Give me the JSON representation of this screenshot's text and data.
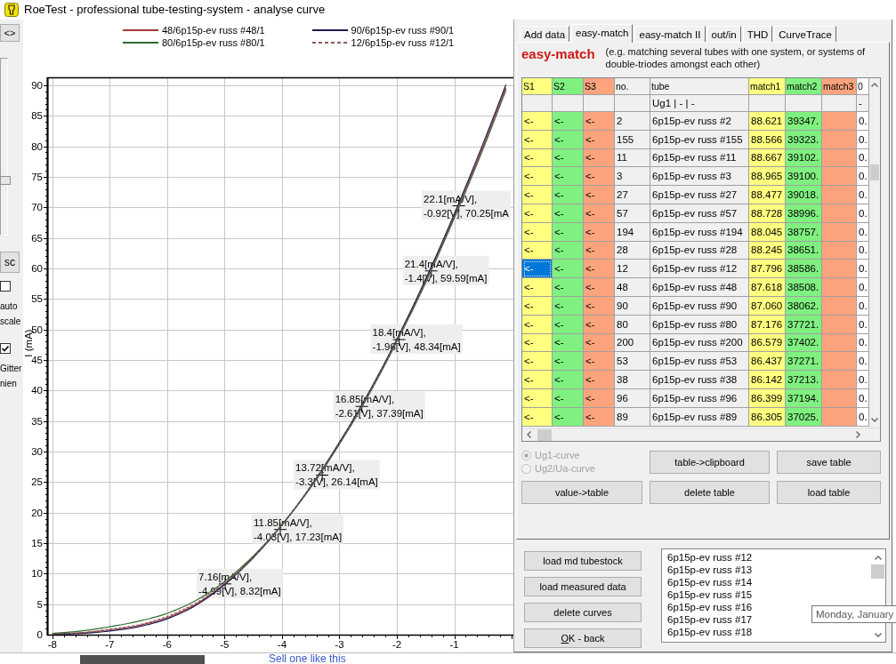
{
  "window": {
    "title": "RoeTest - professional tube-testing-system - analyse curve"
  },
  "left_strip": {
    "toggle_button": "<>",
    "slider": {
      "level": 0.3
    },
    "button": "sc",
    "options": [
      {
        "label": "auto scale",
        "checked": false
      },
      {
        "label": "Gitter nien",
        "checked": true
      }
    ]
  },
  "chart": {
    "chart_data": {
      "type": "line",
      "ylabel": "I (mA)",
      "grid": true,
      "legend": "top",
      "x": [
        -8,
        -7.5,
        -7,
        -6.5,
        -6,
        -5.5,
        -5,
        -4.5,
        -4,
        -3.5,
        -3,
        -2.5,
        -2,
        -1.5,
        -1,
        -0.5,
        -0.1
      ],
      "series": [
        {
          "name": "48/6p15p-ev russ #48/1",
          "color": "#a83a3a",
          "line_style": "solid",
          "values": [
            0.1,
            0.3,
            0.8,
            1.5,
            2.8,
            5.0,
            8.3,
            12.7,
            18.0,
            24.2,
            31.4,
            39.3,
            48.2,
            57.9,
            68.5,
            79.9,
            89.6
          ]
        },
        {
          "name": "90/6p15p-ev russ #90/1",
          "color": "#1a1a50",
          "line_style": "solid",
          "values": [
            0.1,
            0.2,
            0.6,
            1.3,
            2.6,
            4.8,
            8.2,
            12.6,
            18.0,
            24.3,
            31.5,
            39.5,
            48.4,
            58.2,
            68.9,
            80.4,
            90.1
          ]
        },
        {
          "name": "80/6p15p-ev russ #80/1",
          "color": "#2f6b2f",
          "line_style": "solid",
          "values": [
            0.2,
            0.6,
            1.3,
            2.2,
            3.5,
            5.6,
            8.7,
            12.9,
            18.0,
            24.1,
            31.2,
            39.1,
            48.0,
            57.6,
            68.2,
            79.5,
            89.2
          ]
        },
        {
          "name": "12/6p15p-ev russ #12/1",
          "color": "#8a5a5a",
          "line_style": "dashed",
          "values": [
            0.1,
            0.3,
            0.9,
            1.6,
            3.0,
            5.2,
            8.4,
            12.7,
            18.0,
            24.2,
            31.3,
            39.3,
            48.2,
            57.8,
            68.4,
            79.7,
            89.4
          ]
        }
      ],
      "xlim": [
        -8.09,
        0.03
      ],
      "ylim": [
        0,
        91.3
      ],
      "xticks": [
        -8,
        -7,
        -6,
        -5,
        -4,
        -3,
        -2,
        -1
      ],
      "yticks": [
        0,
        5,
        10,
        15,
        20,
        25,
        30,
        35,
        40,
        45,
        50,
        55,
        60,
        65,
        70,
        75,
        80,
        85,
        90
      ],
      "annotations": [
        {
          "x": -4.99,
          "y": 8.32,
          "text": "7.16[mA/V],\n-4.99[V], 8.32[mA]"
        },
        {
          "x": -4.03,
          "y": 17.23,
          "text": "11.85[mA/V],\n-4.03[V], 17.23[mA]"
        },
        {
          "x": -3.3,
          "y": 26.14,
          "text": "13.72[mA/V],\n-3.3[V], 26.14[mA]"
        },
        {
          "x": -2.61,
          "y": 37.39,
          "text": "16.85[mA/V],\n-2.61[V], 37.39[mA]"
        },
        {
          "x": -1.96,
          "y": 48.34,
          "text": "18.4[mA/V],\n-1.96[V], 48.34[mA]"
        },
        {
          "x": -1.4,
          "y": 59.59,
          "text": "21.4[mA/V],\n-1.4[V], 59.59[mA]"
        },
        {
          "x": -0.92,
          "y": 70.25,
          "text": "22.1[mA/V],\n-0.92[V], 70.25[mA"
        }
      ]
    }
  },
  "panel": {
    "tabs": [
      {
        "label": "Add data",
        "selected": false
      },
      {
        "label": "easy-match",
        "selected": true
      },
      {
        "label": "easy-match II",
        "selected": false
      },
      {
        "label": "out/in",
        "selected": false
      },
      {
        "label": "THD",
        "selected": false
      },
      {
        "label": "CurveTrace",
        "selected": false
      }
    ],
    "heading": "easy-match",
    "description": "(e.g. matching several tubes with one system, or systems of double-triodes amongst each other)",
    "table": {
      "columns": [
        {
          "label": "S1",
          "color": "#ffff80"
        },
        {
          "label": "S2",
          "color": "#80f080"
        },
        {
          "label": "S3",
          "color": "#fca47e"
        },
        {
          "label": "no.",
          "color": "#f0f0f0"
        },
        {
          "label": "tube",
          "sub": "Ug1 | - | -",
          "color": "#f0f0f0"
        },
        {
          "label": "match1",
          "color": "#ffff80"
        },
        {
          "label": "match2",
          "color": "#80f080"
        },
        {
          "label": "match3",
          "color": "#fca47e"
        },
        {
          "label": "0",
          "sub": "-",
          "color": "#ffffff"
        }
      ],
      "rows": [
        {
          "s1": "<-",
          "s2": "<-",
          "s3": "<-",
          "no": "2",
          "tube": "6p15p-ev russ #2",
          "match1": "88.621",
          "match2": "39347.",
          "column_9": "0.",
          "selected": false
        },
        {
          "s1": "<-",
          "s2": "<-",
          "s3": "<-",
          "no": "155",
          "tube": "6p15p-ev russ #155",
          "match1": "88.566",
          "match2": "39323.",
          "column_9": "0.",
          "selected": false
        },
        {
          "s1": "<-",
          "s2": "<-",
          "s3": "<-",
          "no": "11",
          "tube": "6p15p-ev russ #11",
          "match1": "88.667",
          "match2": "39102.",
          "column_9": "0.",
          "selected": false
        },
        {
          "s1": "<-",
          "s2": "<-",
          "s3": "<-",
          "no": "3",
          "tube": "6p15p-ev russ #3",
          "match1": "88.965",
          "match2": "39100.",
          "column_9": "0.",
          "selected": false
        },
        {
          "s1": "<-",
          "s2": "<-",
          "s3": "<-",
          "no": "27",
          "tube": "6p15p-ev russ #27",
          "match1": "88.477",
          "match2": "39018.",
          "column_9": "0.",
          "selected": false
        },
        {
          "s1": "<-",
          "s2": "<-",
          "s3": "<-",
          "no": "57",
          "tube": "6p15p-ev russ #57",
          "match1": "88.728",
          "match2": "38996.",
          "column_9": "0.",
          "selected": false
        },
        {
          "s1": "<-",
          "s2": "<-",
          "s3": "<-",
          "no": "194",
          "tube": "6p15p-ev russ #194",
          "match1": "88.045",
          "match2": "38757.",
          "column_9": "0.",
          "selected": false
        },
        {
          "s1": "<-",
          "s2": "<-",
          "s3": "<-",
          "no": "28",
          "tube": "6p15p-ev russ #28",
          "match1": "88.245",
          "match2": "38651.",
          "column_9": "0.",
          "selected": false
        },
        {
          "s1": "<-",
          "s2": "<-",
          "s3": "<-",
          "no": "12",
          "tube": "6p15p-ev russ #12",
          "match1": "87.796",
          "match2": "38586.",
          "column_9": "0.",
          "selected": true
        },
        {
          "s1": "<-",
          "s2": "<-",
          "s3": "<-",
          "no": "48",
          "tube": "6p15p-ev russ #48",
          "match1": "87.618",
          "match2": "38508.",
          "column_9": "0.",
          "selected": false
        },
        {
          "s1": "<-",
          "s2": "<-",
          "s3": "<-",
          "no": "90",
          "tube": "6p15p-ev russ #90",
          "match1": "87.060",
          "match2": "38062.",
          "column_9": "0.",
          "selected": false
        },
        {
          "s1": "<-",
          "s2": "<-",
          "s3": "<-",
          "no": "80",
          "tube": "6p15p-ev russ #80",
          "match1": "87.176",
          "match2": "37721.",
          "column_9": "0.",
          "selected": false
        },
        {
          "s1": "<-",
          "s2": "<-",
          "s3": "<-",
          "no": "200",
          "tube": "6p15p-ev russ #200",
          "match1": "86.579",
          "match2": "37402.",
          "column_9": "0.",
          "selected": false
        },
        {
          "s1": "<-",
          "s2": "<-",
          "s3": "<-",
          "no": "53",
          "tube": "6p15p-ev russ #53",
          "match1": "86.437",
          "match2": "37271.",
          "column_9": "0.",
          "selected": false
        },
        {
          "s1": "<-",
          "s2": "<-",
          "s3": "<-",
          "no": "38",
          "tube": "6p15p-ev russ #38",
          "match1": "86.142",
          "match2": "37213.",
          "column_9": "0.",
          "selected": false
        },
        {
          "s1": "<-",
          "s2": "<-",
          "s3": "<-",
          "no": "96",
          "tube": "6p15p-ev russ #96",
          "match1": "86.399",
          "match2": "37194.",
          "column_9": "0.",
          "selected": false
        },
        {
          "s1": "<-",
          "s2": "<-",
          "s3": "<-",
          "no": "89",
          "tube": "6p15p-ev russ #89",
          "match1": "86.305",
          "match2": "37025.",
          "column_9": "0.",
          "selected": false
        }
      ]
    },
    "curve_type": [
      {
        "label": "Ug1-curve",
        "selected": true,
        "disabled": true
      },
      {
        "label": "Ug2/Ua-curve",
        "selected": false,
        "disabled": true
      }
    ],
    "buttons": [
      "table->clipboard",
      "save table",
      "value->table",
      "delete table",
      "load table"
    ]
  },
  "actions": {
    "buttons": [
      {
        "label": "load md tubestock",
        "mnemonic": false
      },
      {
        "label": "load measured data",
        "mnemonic": false
      },
      {
        "label": "delete curves",
        "mnemonic": false
      },
      {
        "label": "OK - back",
        "mnemonic": true
      }
    ],
    "tube_list": [
      "6p15p-ev russ #12",
      "6p15p-ev russ #13",
      "6p15p-ev russ #14",
      "6p15p-ev russ #15",
      "6p15p-ev russ #16",
      "6p15p-ev russ #17",
      "6p15p-ev russ #18"
    ]
  },
  "tooltip": "Monday, January",
  "background_page": {
    "link": "Sell one like this"
  }
}
